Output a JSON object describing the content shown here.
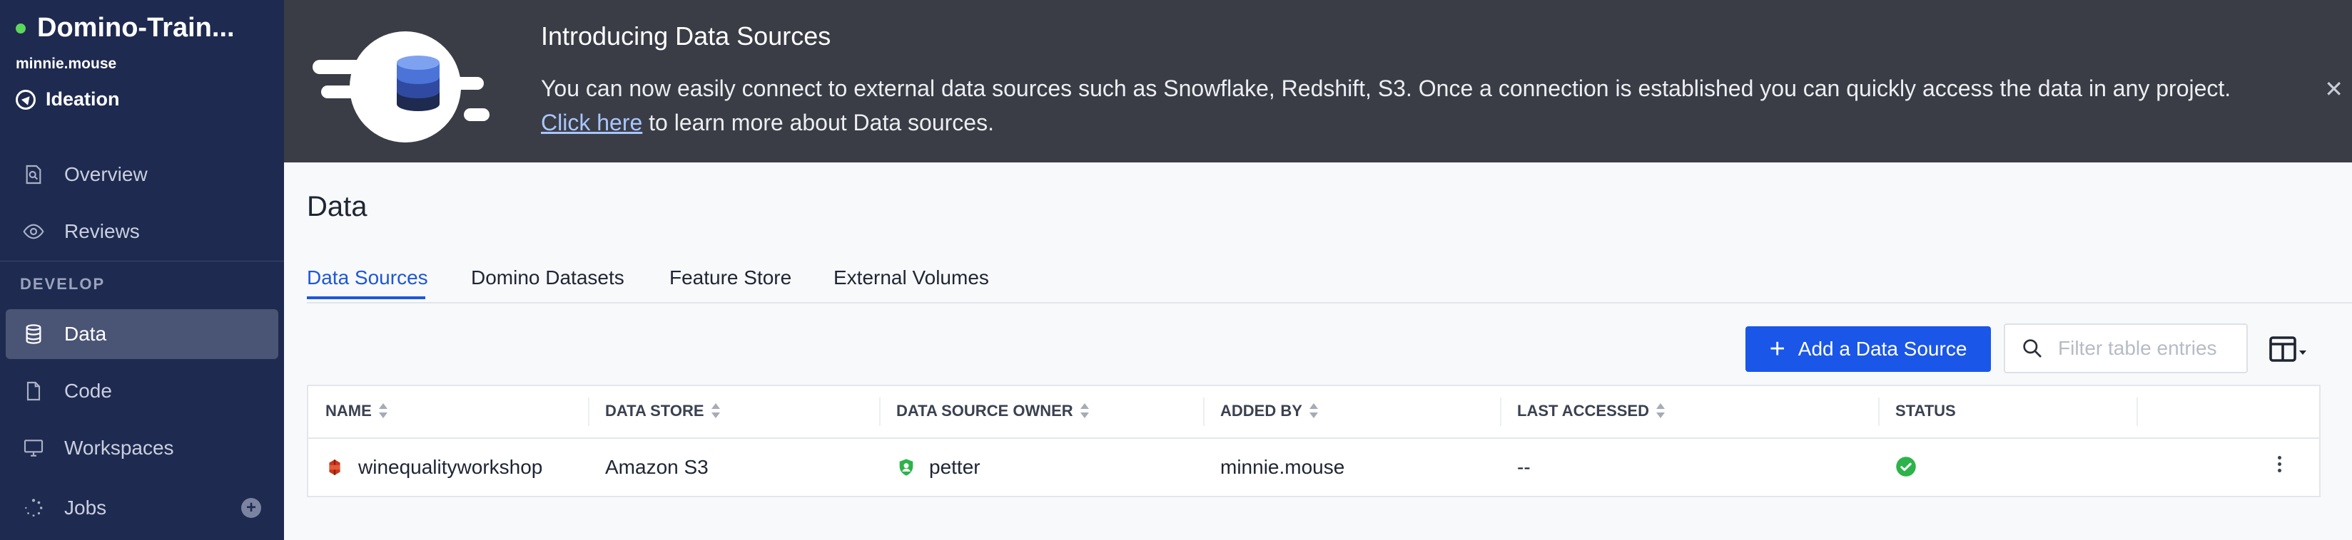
{
  "sidebar": {
    "project_name": "Domino-Train...",
    "user": "minnie.mouse",
    "stage": "Ideation",
    "section_develop": "DEVELOP",
    "items": [
      {
        "label": "Overview",
        "icon": "report-search-icon"
      },
      {
        "label": "Reviews",
        "icon": "eye-icon"
      },
      {
        "label": "Data",
        "icon": "database-icon",
        "active": true
      },
      {
        "label": "Code",
        "icon": "file-icon"
      },
      {
        "label": "Workspaces",
        "icon": "monitor-icon"
      },
      {
        "label": "Jobs",
        "icon": "spinner-icon"
      }
    ]
  },
  "banner": {
    "title": "Introducing Data Sources",
    "text_before": "You can now easily connect to external data sources such as Snowflake, Redshift, S3. Once a connection is established you can quickly access the data in any project. ",
    "link": "Click here",
    "text_after": " to learn more about Data sources."
  },
  "page": {
    "title": "Data",
    "tabs": [
      "Data Sources",
      "Domino Datasets",
      "Feature Store",
      "External Volumes"
    ],
    "active_tab": "Data Sources"
  },
  "toolbar": {
    "add_label": "Add a Data Source",
    "filter_placeholder": "Filter table entries"
  },
  "table": {
    "headers": [
      "NAME",
      "DATA STORE",
      "DATA SOURCE OWNER",
      "ADDED BY",
      "LAST ACCESSED",
      "STATUS"
    ],
    "rows": [
      {
        "name": "winequalityworkshop",
        "data_store": "Amazon S3",
        "owner": "petter",
        "added_by": "minnie.mouse",
        "last_accessed": "--",
        "status": "ok"
      }
    ]
  },
  "colors": {
    "sidebar_bg": "#1e2a4f",
    "banner_bg": "#3a3d46",
    "accent": "#1a56e8",
    "status_ok": "#2db34a"
  }
}
